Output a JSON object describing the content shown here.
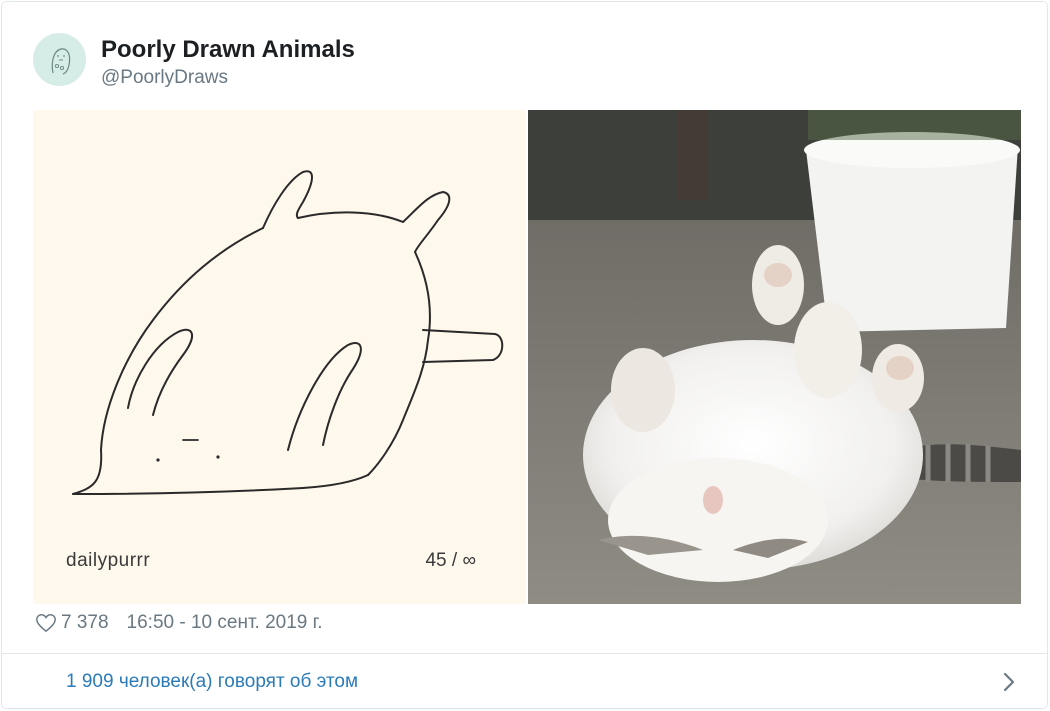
{
  "tweet": {
    "author_name": "Poorly Drawn Animals",
    "author_handle": "@PoorlyDraws",
    "likes": "7 378",
    "timestamp": "16:50 - 10 сент. 2019 г.",
    "discussion": "1 909 человек(а) говорят об этом"
  },
  "media": {
    "drawing": {
      "brand": "dailypurrr",
      "counter": "45 / ∞"
    }
  },
  "icons": {
    "like": "heart-outline-icon",
    "more": "chevron-right-icon"
  },
  "colors": {
    "link": "#2b7bb9",
    "muted": "#697882",
    "avatar_bg": "#d6ece6",
    "drawing_bg": "#fef8ed"
  }
}
